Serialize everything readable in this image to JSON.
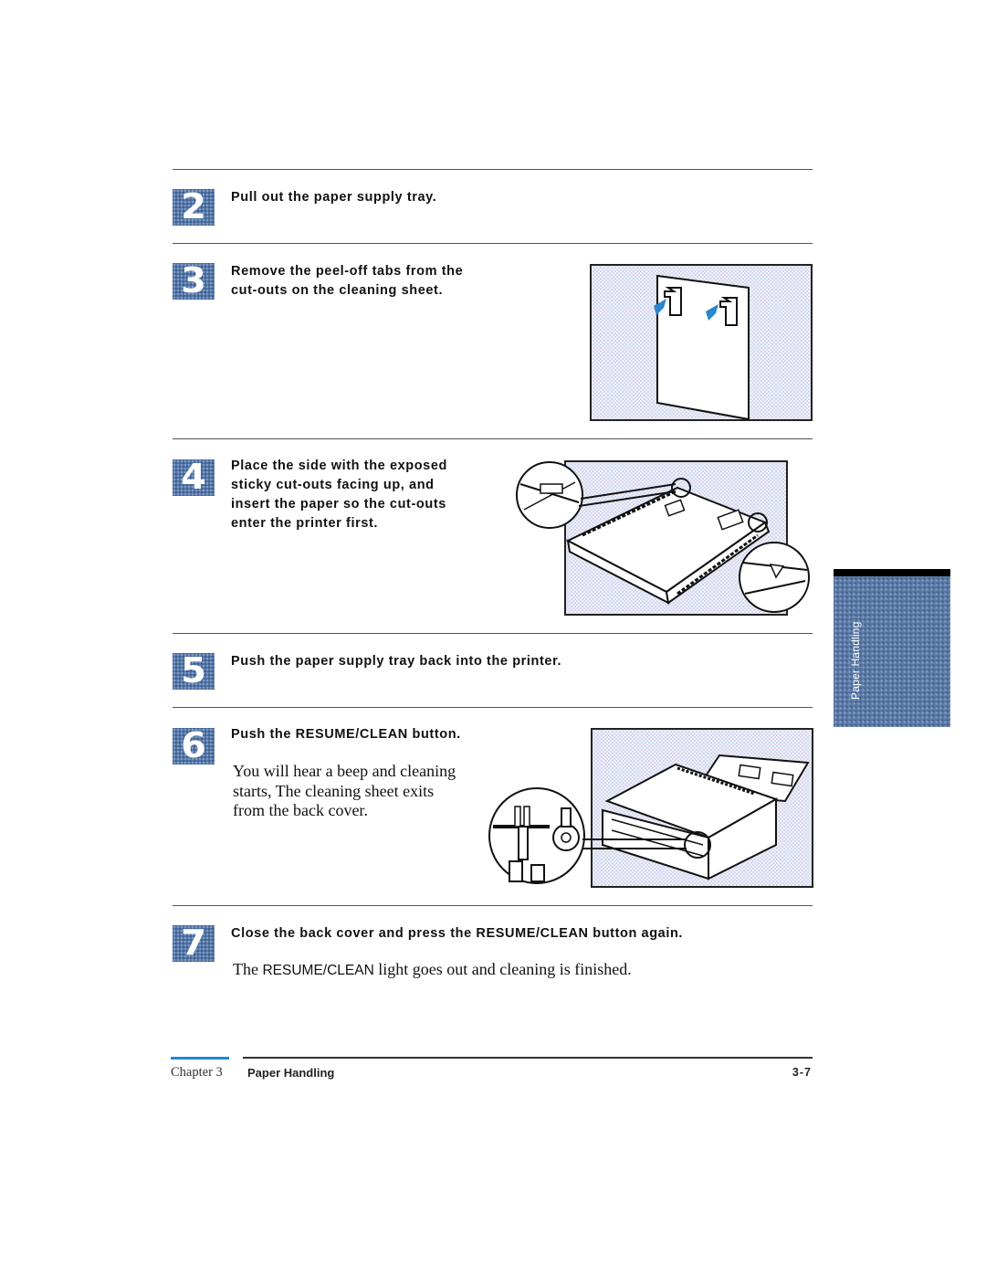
{
  "steps": [
    {
      "number": "2",
      "heading": "Pull out the paper supply tray."
    },
    {
      "number": "3",
      "heading_lines": [
        "Remove the peel-off tabs from the",
        "cut-outs on the cleaning sheet."
      ]
    },
    {
      "number": "4",
      "heading_lines": [
        "Place the side with the exposed",
        "sticky cut-outs facing up, and",
        "insert the paper so the cut-outs",
        "enter the printer first."
      ]
    },
    {
      "number": "5",
      "heading": "Push the paper supply tray back into the printer."
    },
    {
      "number": "6",
      "heading": "Push the RESUME/CLEAN button.",
      "body_lines": [
        "You will hear a beep and cleaning",
        "starts, The cleaning sheet exits",
        "from the back cover."
      ]
    },
    {
      "number": "7",
      "heading": "Close the back cover and press the RESUME/CLEAN button again.",
      "body_prefix": "The ",
      "body_sans": "RESUME/CLEAN",
      "body_suffix": " light goes out and cleaning is finished."
    }
  ],
  "figures": {
    "cleaning_sheet": {
      "icon": "cleaning-sheet-with-peel-tabs",
      "accent": "#2a86cf"
    },
    "paper_tray": {
      "icon": "paper-tray-with-cleaning-sheet"
    },
    "printer": {
      "icon": "printer-resume-clean-button"
    }
  },
  "side_tab": {
    "label": "Paper Handling",
    "color": "#5a79a6"
  },
  "footer": {
    "chapter": "Chapter 3",
    "title": "Paper Handling",
    "page": "3-7",
    "accent_color": "#1d8ad6"
  }
}
